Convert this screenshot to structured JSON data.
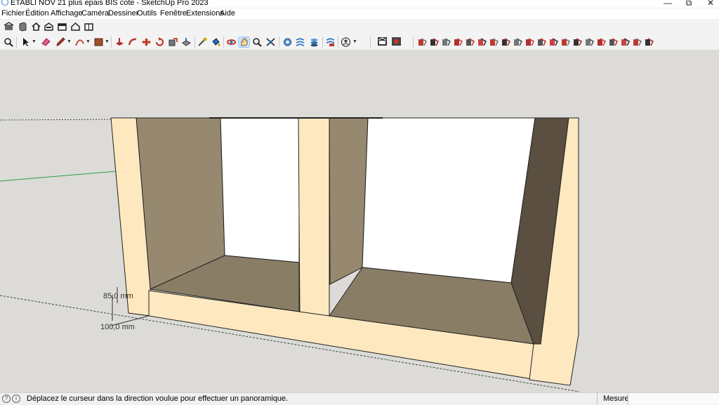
{
  "window": {
    "title": "ETABLI NOV 21 plus epais BIS cote - SketchUp Pro 2023",
    "minimize": "—",
    "maximize": "⧉",
    "close": "✕"
  },
  "menu": [
    "Fichier",
    "Édition",
    "Affichage",
    "Caméra",
    "Dessiner",
    "Outils",
    "Fenêtre",
    "Extensions",
    "Aide"
  ],
  "dimensions": {
    "thickness": "85,0 mm",
    "length": "100,0 mm"
  },
  "status": {
    "message": "Déplacez le curseur dans la direction voulue pour effectuer un panoramique.",
    "measurements_label": "Mesures",
    "measurements_value": ""
  },
  "colors": {
    "viewport_bg": "#dcdbd7",
    "wood_face": "#fde8c0",
    "inner_dark": "#5a4f40",
    "inner_mid": "#968970",
    "inner_floor": "#897d66",
    "green_axis": "#2e9e3e",
    "selected_tool_bg": "#cce4f7"
  },
  "toolbar_icons": {
    "row1": [
      "warehouse-icon",
      "component-icon",
      "home-icon",
      "front-view-icon",
      "side-view-icon",
      "back-view-icon",
      "left-view-icon"
    ],
    "row2_left": [
      "zoom-icon",
      "select-icon",
      "eraser-icon",
      "pencil-icon",
      "arc-icon",
      "shape-icon",
      "push-pull-icon",
      "follow-me-icon",
      "move-icon",
      "rotate-icon",
      "scale-icon",
      "offset-icon",
      "tape-measure-icon",
      "paint-bucket-icon",
      "orbit-icon",
      "pan-icon",
      "zoom-window-icon",
      "zoom-extents-icon",
      "position-camera-icon",
      "walk-icon",
      "look-around-icon",
      "section-plane-icon",
      "user-icon"
    ],
    "row2_right": [
      "extension-warehouse-icon",
      "layout-icon",
      "tool-a-icon",
      "tool-b-icon",
      "tool-c-icon",
      "tool-d-icon",
      "tool-e-icon",
      "tool-f-icon",
      "tool-g-icon",
      "tool-h-icon",
      "tool-i-icon",
      "tool-j-icon",
      "tool-k-icon",
      "tool-l-icon",
      "tool-m-icon",
      "tool-n-icon",
      "tool-o-icon",
      "tool-p-icon",
      "tool-q-icon",
      "tool-r-icon",
      "tool-s-icon",
      "tool-t-icon"
    ]
  }
}
